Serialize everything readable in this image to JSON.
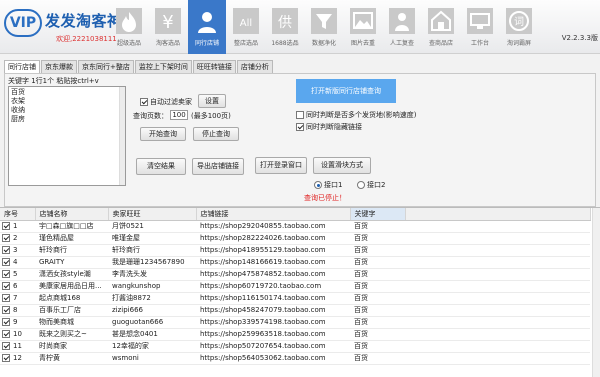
{
  "app": {
    "logo_text": "VIP",
    "title": "发发淘客神器",
    "qq": "欢迎,2221038111",
    "version": "V2.2.3.3版"
  },
  "toolbar": [
    {
      "label": "超级选品",
      "icon": "fire-icon"
    },
    {
      "label": "淘客选品",
      "icon": "yen-icon"
    },
    {
      "label": "同行店铺",
      "icon": "user-icon"
    },
    {
      "label": "整店选品",
      "icon": "all-icon"
    },
    {
      "label": "1688选品",
      "icon": "supply-icon"
    },
    {
      "label": "数据净化",
      "icon": "filter-icon"
    },
    {
      "label": "图片去重",
      "icon": "image-icon"
    },
    {
      "label": "人工复查",
      "icon": "worker-icon"
    },
    {
      "label": "查商品店",
      "icon": "shop-icon"
    },
    {
      "label": "工作台",
      "icon": "desk-icon"
    },
    {
      "label": "淘词霸屏",
      "icon": "word-icon"
    }
  ],
  "tabs": [
    "同行店铺",
    "京东爆款",
    "京东同行+整店",
    "监控上下架时间",
    "旺旺转链接",
    "店铺分析"
  ],
  "keyword": {
    "label": "关键字 1行1个 粘贴按ctrl+v",
    "lines": [
      "百货",
      "衣架",
      "收纳",
      "厨房"
    ]
  },
  "controls": {
    "auto_filter": "自动过滤卖家",
    "settings": "设置",
    "pages_label": "查询页数：",
    "pages_value": "100",
    "pages_hint": "(最多100页)",
    "start": "开始查询",
    "stop": "停止查询",
    "open_shop": "打开新版同行店铺查询",
    "check_sold": "同时判断是否多个发货地(影响速度)",
    "hide_link": "同时判断隐藏链接",
    "clear": "清空结果",
    "export": "导出店铺链接",
    "login": "打开登录窗口",
    "slider": "设置滑块方式",
    "api1": "接口1",
    "api2": "接口2",
    "status": "查询已停止！"
  },
  "table": {
    "headers": [
      "序号",
      "店铺名称",
      "卖家旺旺",
      "店铺链接",
      "关键字"
    ],
    "rows": [
      [
        "1",
        "宇□森□旗□□店",
        "月饼0521",
        "https://shop292040855.taobao.com",
        "百货"
      ],
      [
        "2",
        "瑾色精品屋",
        "唯瑾金屋",
        "https://shop282224026.taobao.com",
        "百货"
      ],
      [
        "3",
        "轩玲商行",
        "轩玲商行",
        "https://shop418955129.taobao.com",
        "百货"
      ],
      [
        "4",
        "GRAITY",
        "我是珊珊1234567890",
        "https://shop148166619.taobao.com",
        "百货"
      ],
      [
        "5",
        "潇洒女孩style潮",
        "李青洗头发",
        "https://shop475874852.taobao.com",
        "百货"
      ],
      [
        "6",
        "美康家居用品日用...",
        "wangkunshop",
        "https://shop60719720.taobao.com",
        "百货"
      ],
      [
        "7",
        "起点商城168",
        "打酱油8872",
        "https://shop116150174.taobao.com",
        "百货"
      ],
      [
        "8",
        "百事乐工厂店",
        "zizipi666",
        "https://shop458247079.taobao.com",
        "百货"
      ],
      [
        "9",
        "物而美商城",
        "guoguotan666",
        "https://shop339574198.taobao.com",
        "百货"
      ],
      [
        "10",
        "既来之则买之~",
        "甚是想念0401",
        "https://shop259963518.taobao.com",
        "百货"
      ],
      [
        "11",
        "时尚商家",
        "12幸福的家",
        "https://shop507207654.taobao.com",
        "百货"
      ],
      [
        "12",
        "青柠黄",
        "wsmoni",
        "https://shop564053062.taobao.com",
        "百货"
      ]
    ]
  },
  "colors": {
    "accent": "#3a78c9",
    "primary_button": "#5aa7ee",
    "status": "#e02020",
    "logo": "#2b6fc2"
  }
}
